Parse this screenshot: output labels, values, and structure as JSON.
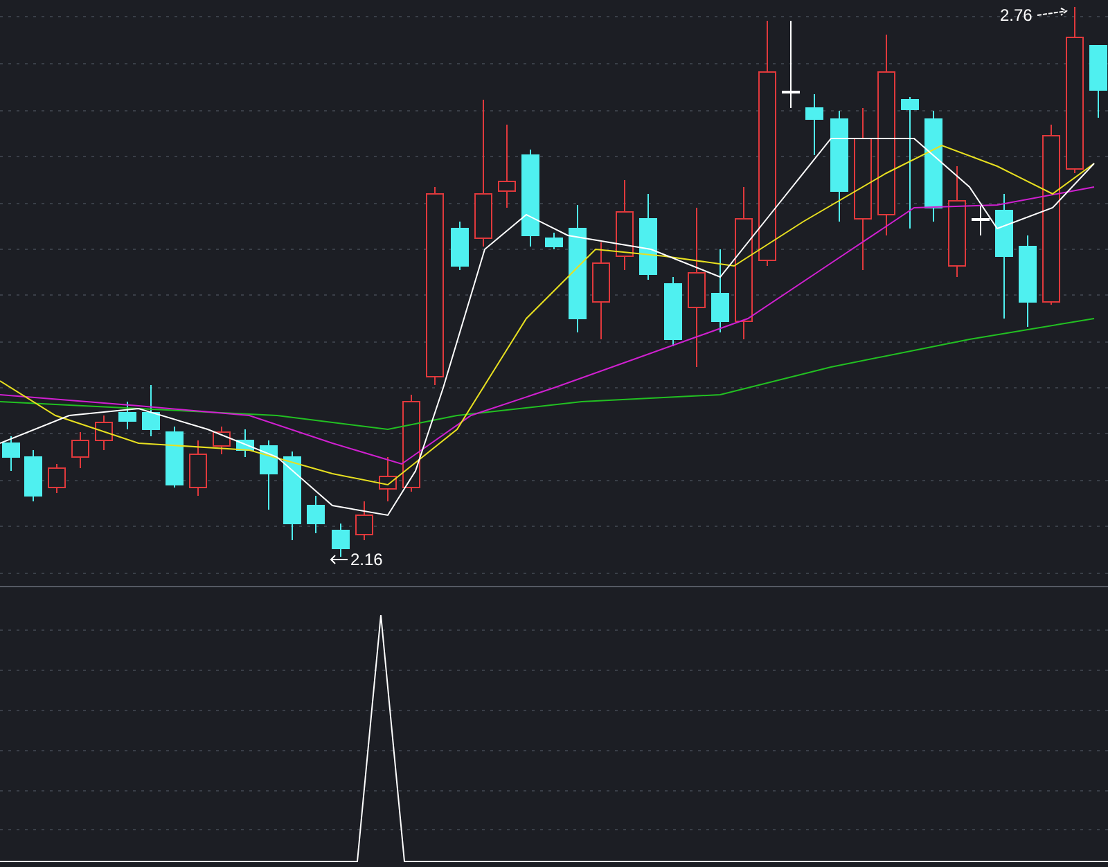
{
  "price_chart": {
    "high_marker": "2.76",
    "low_marker": "2.16"
  }
}
